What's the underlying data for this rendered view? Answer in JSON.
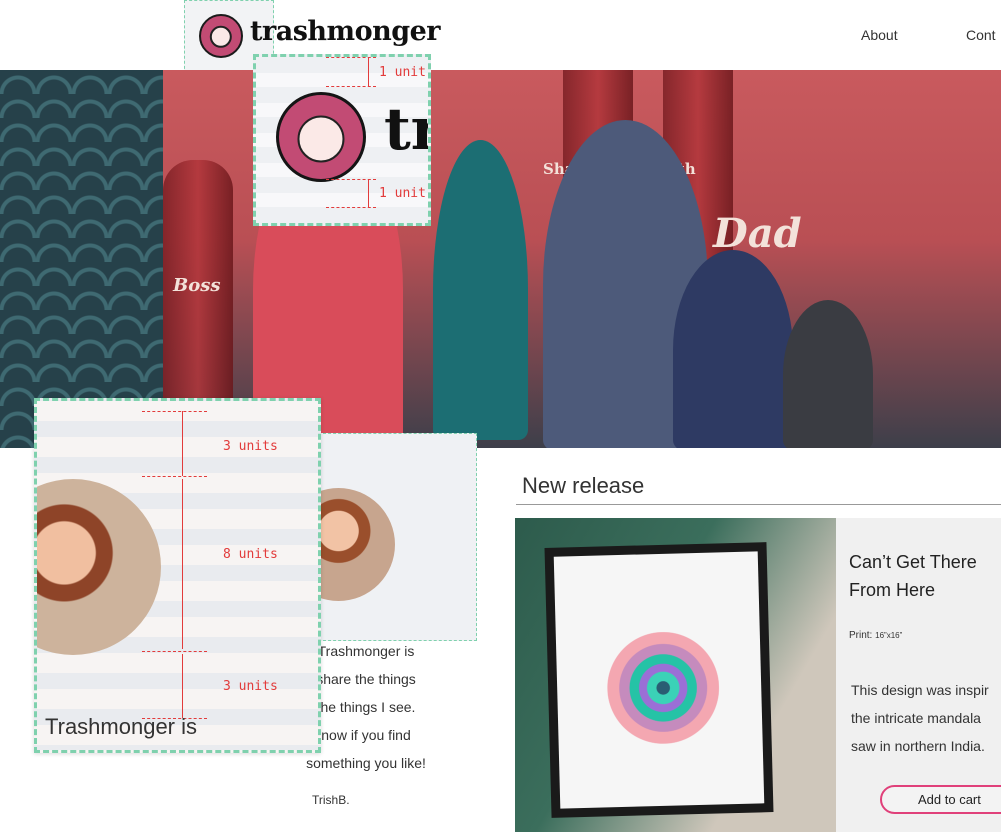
{
  "header": {
    "brand": "trashmonger",
    "nav": [
      {
        "label": "About"
      },
      {
        "label": "Cont"
      }
    ]
  },
  "logo_spec": {
    "brand_crop": "tr",
    "top_spacing": "1 unit",
    "bottom_spacing": "1 unit"
  },
  "hero": {
    "photo_text_1": "Share a Coke with",
    "photo_text_2": "Dad",
    "photo_text_3": "Boss"
  },
  "portrait_spec": {
    "top_spacing": "3 units",
    "portrait_size": "8 units",
    "bottom_spacing": "3 units",
    "caption": "Trashmonger is"
  },
  "about": {
    "lines": [
      "Trashmonger is",
      "share the things",
      "the things I see.",
      "now if you find",
      "something you like!"
    ],
    "signature": "TrishB."
  },
  "release": {
    "section_title": "New release",
    "product_name": "Can’t Get There From Here",
    "print_label": "Print:",
    "print_size": "16”x16”",
    "description_lines": [
      "This design was inspir",
      "the intricate mandala",
      "saw in northern India."
    ],
    "cta": "Add to cart"
  },
  "colors": {
    "brand_pink": "#c24b74",
    "accent_green_dashed": "#7fd1ae",
    "spec_red": "#e23b3b",
    "cta_border": "#e0407a",
    "pattern_teal": "#26414a"
  }
}
